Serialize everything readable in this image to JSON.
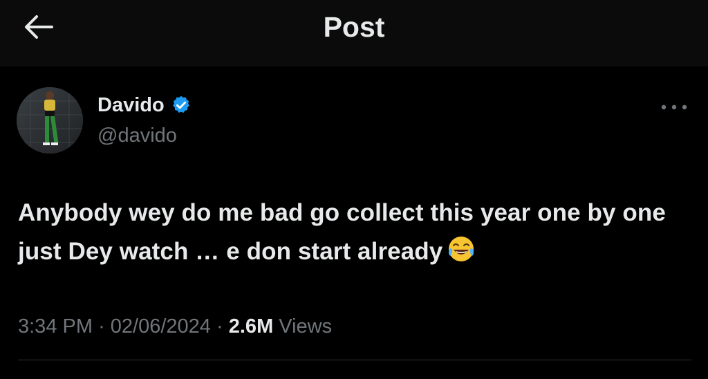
{
  "header": {
    "title": "Post",
    "back_icon": "arrow-left-icon"
  },
  "post": {
    "author": {
      "name": "Davido",
      "handle": "@davido",
      "verified": true,
      "verified_color": "#1d9bf0"
    },
    "text": "Anybody wey do me bad go collect this year one by one just Dey watch … e don start already",
    "emoji": "face-with-tears-of-joy-icon",
    "time": "3:34 PM",
    "date": "02/06/2024",
    "views_count": "2.6M",
    "views_label": "Views",
    "separator": "·",
    "more_icon": "more-horizontal-icon"
  },
  "colors": {
    "background": "#000000",
    "header_background": "#0b0b0b",
    "primary_text": "#e7e9ea",
    "secondary_text": "#71767b",
    "divider": "#2f3336"
  }
}
